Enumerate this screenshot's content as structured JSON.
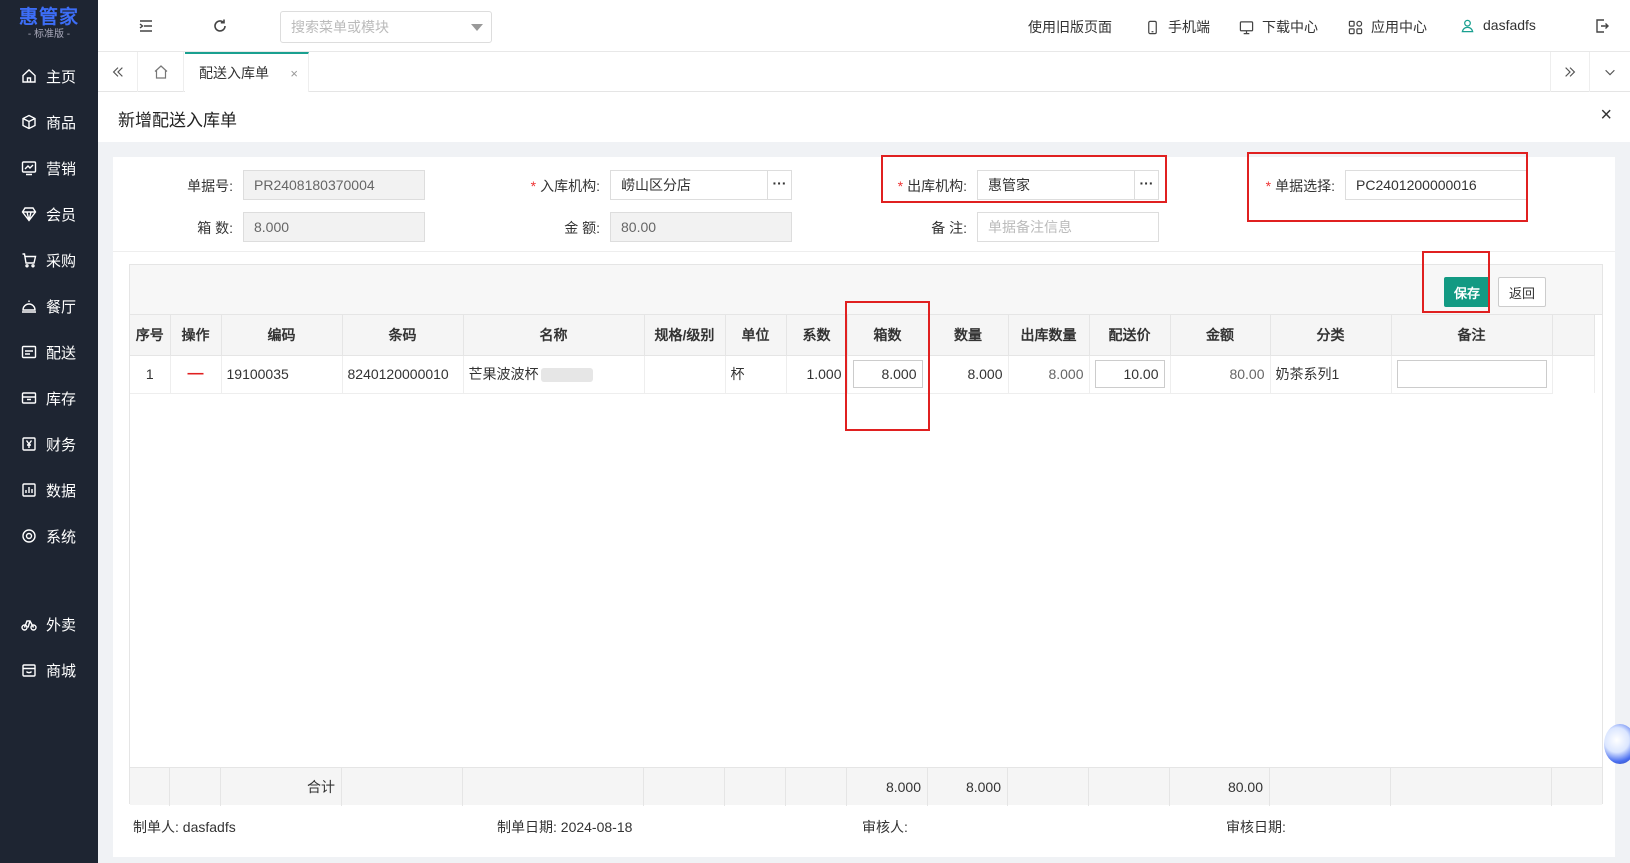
{
  "logo": {
    "main": "惠管家",
    "sub": "- 标准版 -"
  },
  "nav": [
    {
      "label": "主页",
      "icon": "home-icon"
    },
    {
      "label": "商品",
      "icon": "box-icon"
    },
    {
      "label": "营销",
      "icon": "chart-icon"
    },
    {
      "label": "会员",
      "icon": "diamond-icon"
    },
    {
      "label": "采购",
      "icon": "cart-icon"
    },
    {
      "label": "餐厅",
      "icon": "cloche-icon"
    },
    {
      "label": "配送",
      "icon": "truck-icon"
    },
    {
      "label": "库存",
      "icon": "inbox-icon"
    },
    {
      "label": "财务",
      "icon": "yen-icon"
    },
    {
      "label": "数据",
      "icon": "bar-chart-icon"
    },
    {
      "label": "系统",
      "icon": "settings-icon"
    },
    {
      "label": "外卖",
      "icon": "bike-icon"
    },
    {
      "label": "商城",
      "icon": "store-icon"
    }
  ],
  "topbar": {
    "search_placeholder": "搜索菜单或模块",
    "old_page": "使用旧版页面",
    "mobile": "手机端",
    "download": "下载中心",
    "apps": "应用中心",
    "user": "dasfadfs"
  },
  "tab": {
    "label": "配送入库单",
    "close": "×"
  },
  "page": {
    "title": "新增配送入库单",
    "close": "×"
  },
  "form": {
    "doc_no_label": "单据号:",
    "doc_no": "PR2408180370004",
    "in_org_label": "入库机构:",
    "in_org": "崂山区分店",
    "out_org_label": "出库机构:",
    "out_org": "惠管家",
    "doc_select_label": "单据选择:",
    "doc_select": "PC2401200000016",
    "boxes_label": "箱 数:",
    "boxes": "8.000",
    "amount_label": "金 额:",
    "amount": "80.00",
    "remark_label": "备 注:",
    "remark_placeholder": "单据备注信息",
    "dots": "···",
    "required_mark": "*"
  },
  "buttons": {
    "save": "保存",
    "back": "返回"
  },
  "table": {
    "headers": [
      "序号",
      "操作",
      "编码",
      "条码",
      "名称",
      "规格/级别",
      "单位",
      "系数",
      "箱数",
      "数量",
      "出库数量",
      "配送价",
      "金额",
      "分类",
      "备注"
    ],
    "rows": [
      {
        "idx": "1",
        "op": "—",
        "code": "19100035",
        "barcode": "8240120000010",
        "name": "芒果波波杯",
        "spec": "",
        "unit": "杯",
        "factor": "1.000",
        "boxes": "8.000",
        "qty": "8.000",
        "out_qty": "8.000",
        "price": "10.00",
        "amount": "80.00",
        "category": "奶茶系列1",
        "remark": ""
      }
    ],
    "footer": {
      "label": "合计",
      "boxes": "8.000",
      "qty": "8.000",
      "amount": "80.00"
    }
  },
  "meta": {
    "creator_label": "制单人:",
    "creator": "dasfadfs",
    "create_date_label": "制单日期:",
    "create_date": "2024-08-18",
    "auditor_label": "审核人:",
    "auditor": "",
    "audit_date_label": "审核日期:",
    "audit_date": ""
  },
  "colors": {
    "sidebar": "#1e2532",
    "accent": "#139a83",
    "highlight": "#e02020",
    "logo": "#3d6ef7"
  }
}
